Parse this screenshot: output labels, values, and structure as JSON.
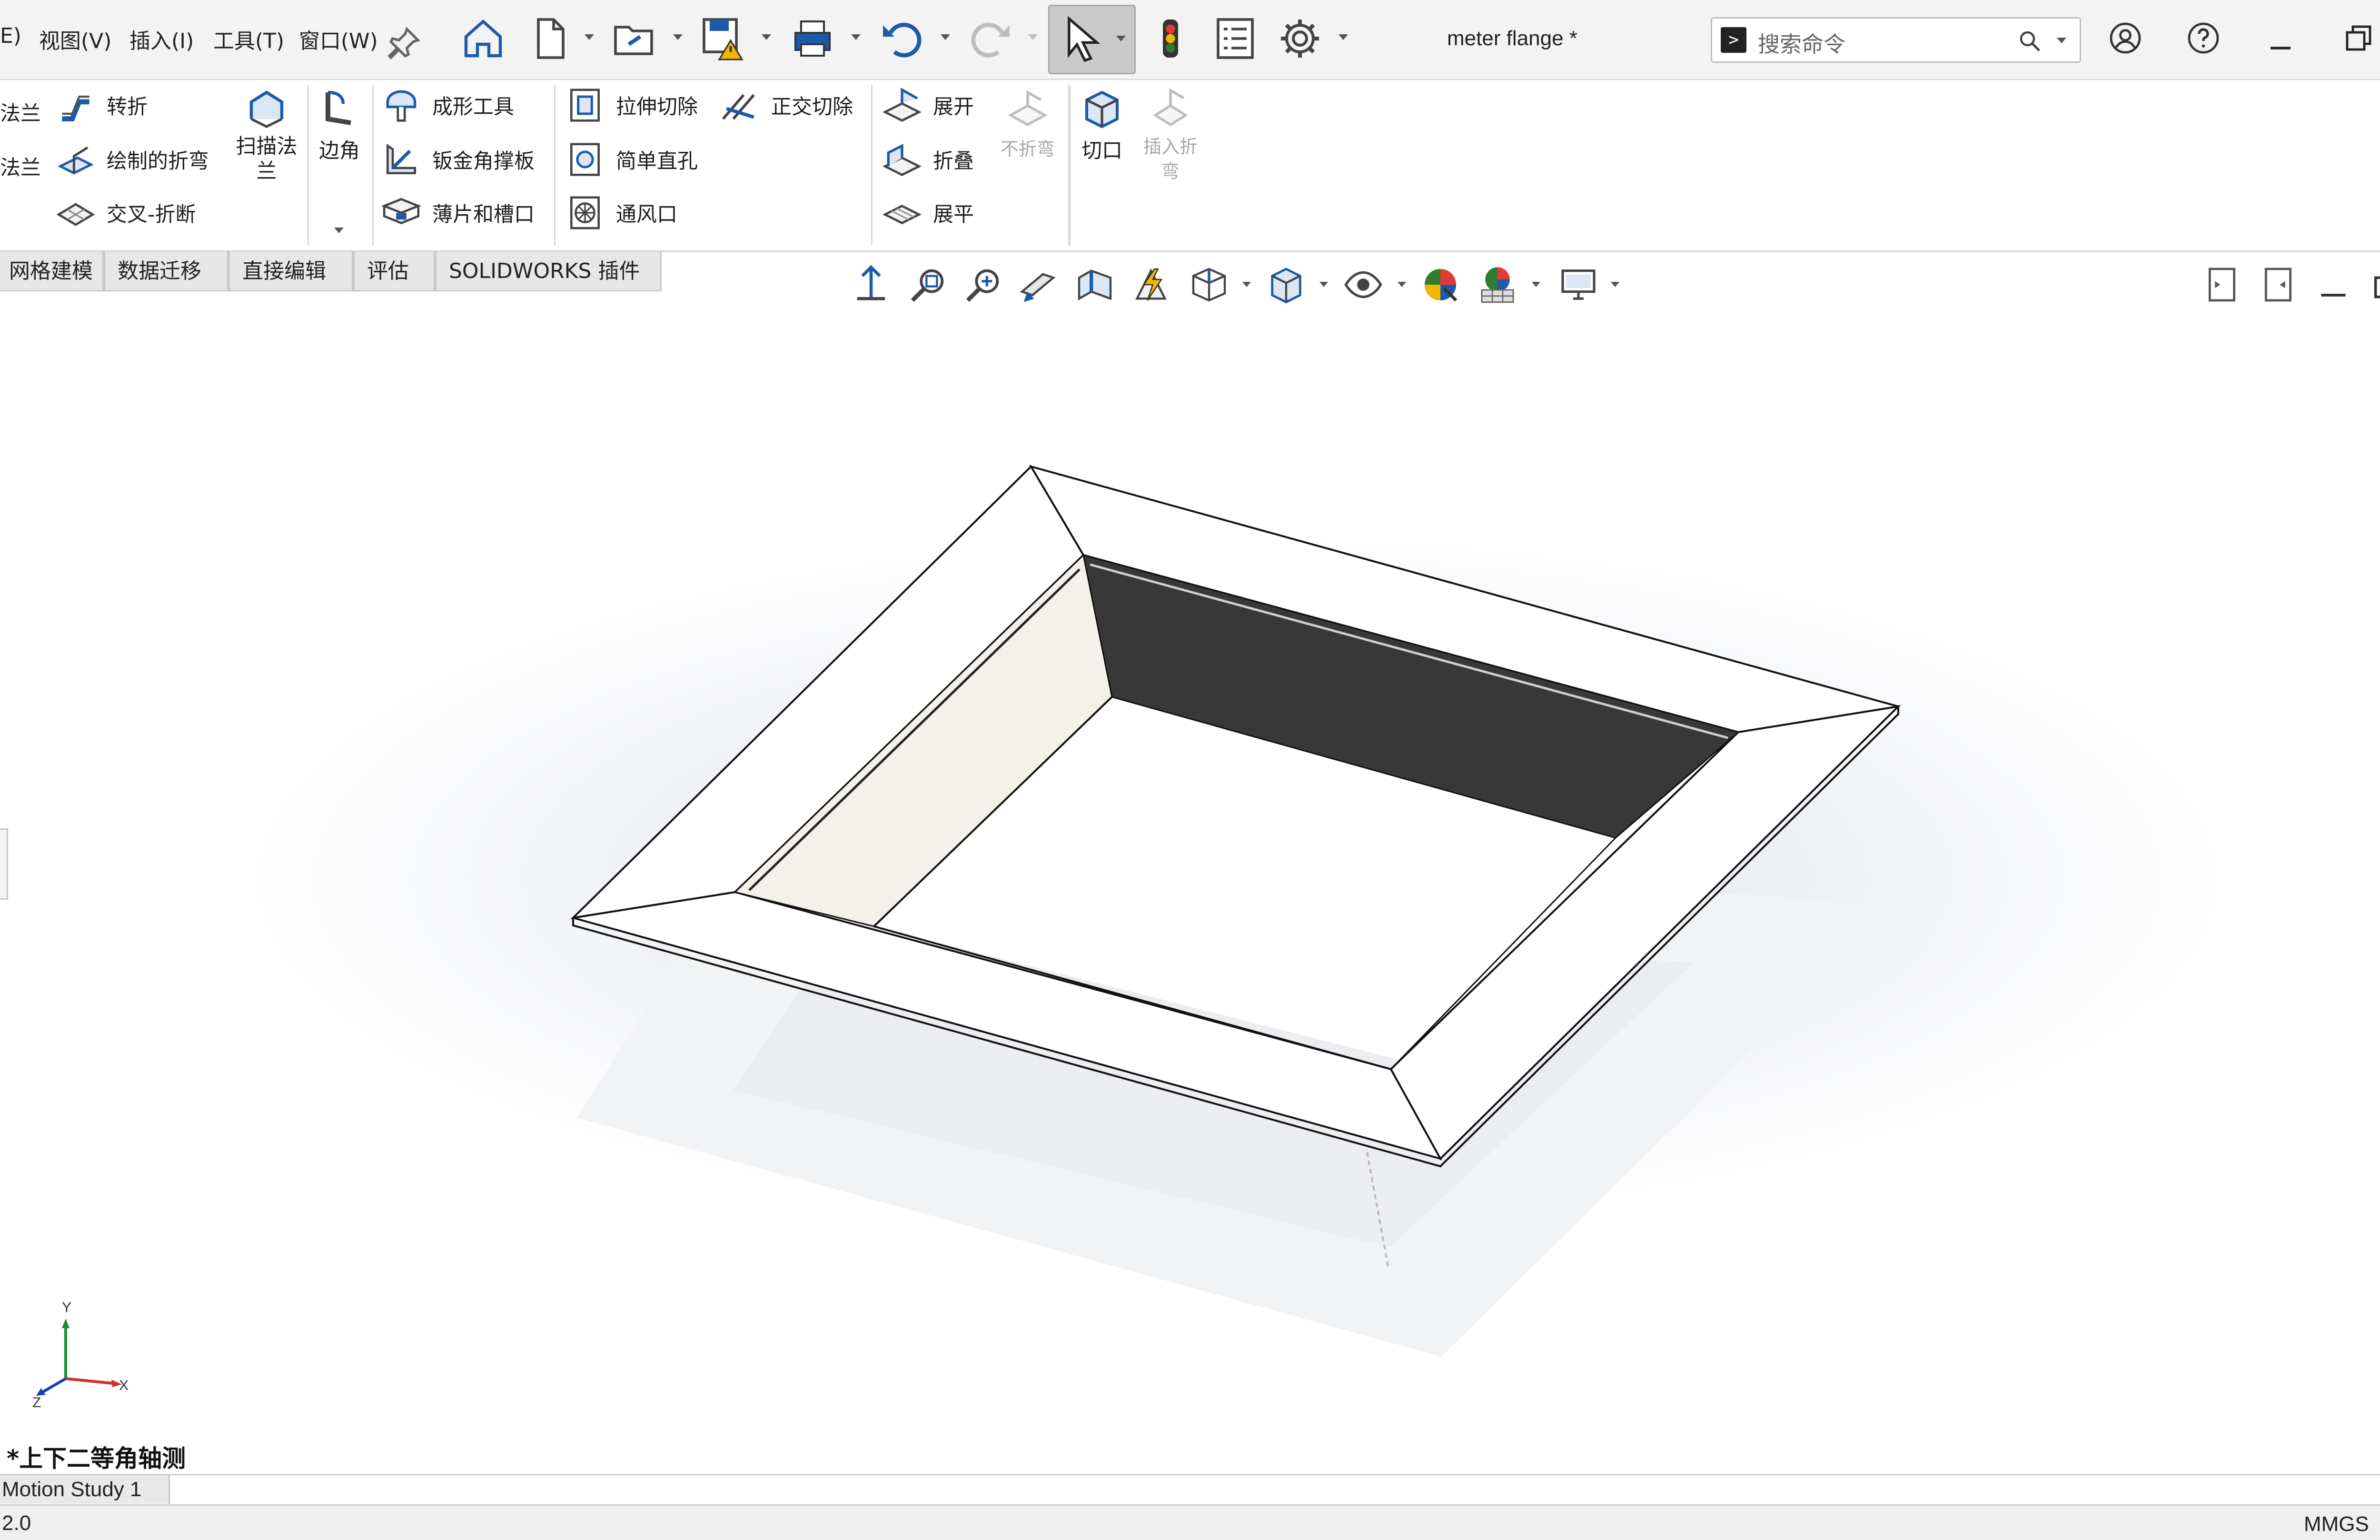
{
  "menu": [
    "E)",
    "视图(V)",
    "插入(I)",
    "工具(T)",
    "窗口(W)"
  ],
  "document_title": "meter flange *",
  "search": {
    "placeholder": "搜索命令"
  },
  "ribbon": {
    "frag_top": "法兰",
    "frag_mid": "法兰",
    "jog": "转折",
    "sketched_bend": "绘制的折弯",
    "cross_break": "交叉-折断",
    "swept_flange": "扫描法兰",
    "hem": "边角",
    "forming_tool": "成形工具",
    "sheet_gusset": "钣金角撑板",
    "tab_slot": "薄片和槽口",
    "extruded_cut": "拉伸切除",
    "normal_cut": "正交切除",
    "simple_hole": "简单直孔",
    "vent": "通风口",
    "unfold": "展开",
    "fold": "折叠",
    "flatten": "展平",
    "no_bends": "不折弯",
    "rip": "切口",
    "insert_bends": "插入折弯"
  },
  "tabs": [
    "网格建模",
    "数据迁移",
    "直接编辑",
    "评估",
    "SOLIDWORKS 插件"
  ],
  "view_name": "*上下二等角轴测",
  "motion_tab": "Motion Study 1",
  "status": {
    "left": "2.0",
    "units": "MMGS"
  },
  "triad": {
    "x": "X",
    "y": "Y",
    "z": "Z"
  },
  "colors": {
    "accent_blue": "#1d5aa8",
    "warning_yellow": "#f2b600",
    "dark_face": "#3b3b3b"
  }
}
